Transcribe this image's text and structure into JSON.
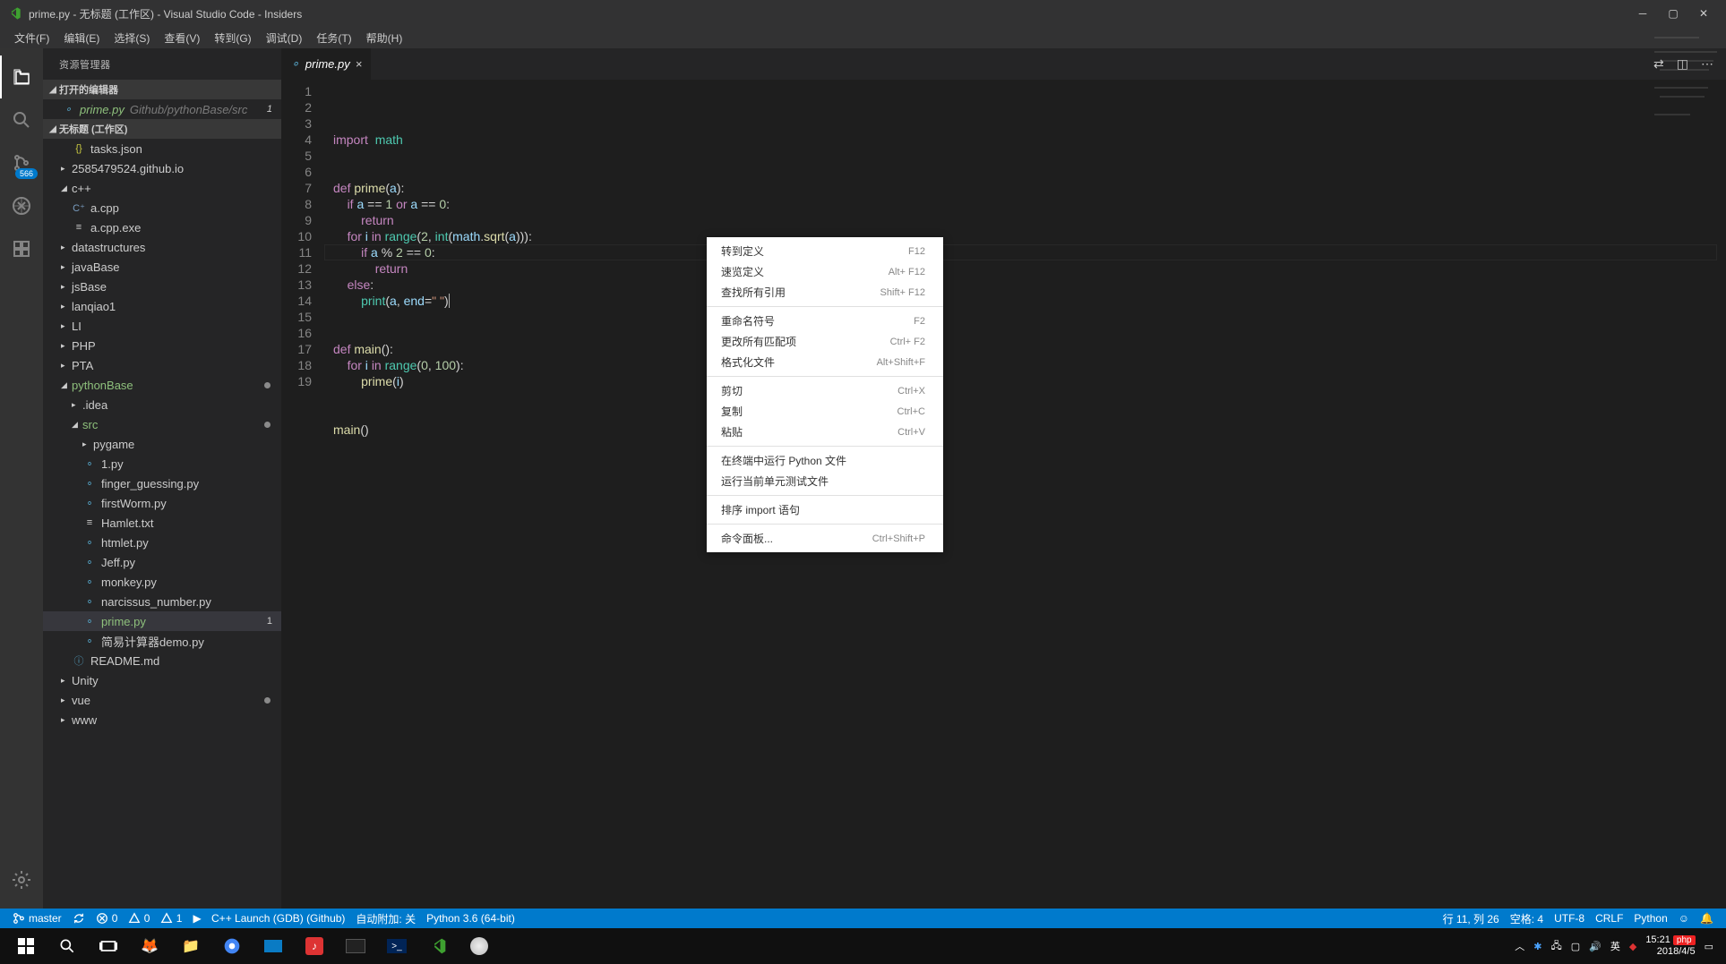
{
  "window": {
    "title": "prime.py - 无标题 (工作区) - Visual Studio Code - Insiders"
  },
  "menu": [
    "文件(F)",
    "编辑(E)",
    "选择(S)",
    "查看(V)",
    "转到(G)",
    "调试(D)",
    "任务(T)",
    "帮助(H)"
  ],
  "activity": {
    "scm_badge": "566"
  },
  "explorer": {
    "title": "资源管理器",
    "openEditorsHeader": "打开的编辑器",
    "openEditor": {
      "name": "prime.py",
      "path": "Github/pythonBase/src",
      "num": "1"
    },
    "workspaceHeader": "无标题 (工作区)",
    "tree": {
      "tasksjson": "tasks.json",
      "github": "2585479524.github.io",
      "cpp": "c++",
      "acpp": "a.cpp",
      "acppexe": "a.cpp.exe",
      "datastructures": "datastructures",
      "javaBase": "javaBase",
      "jsBase": "jsBase",
      "lanqiao1": "lanqiao1",
      "LI": "LI",
      "PHP": "PHP",
      "PTA": "PTA",
      "pythonBase": "pythonBase",
      "idea": ".idea",
      "src": "src",
      "pygame": "pygame",
      "1py": "1.py",
      "finger": "finger_guessing.py",
      "firstWorm": "firstWorm.py",
      "hamlet": "Hamlet.txt",
      "htmlet": "htmlet.py",
      "jeff": "Jeff.py",
      "monkey": "monkey.py",
      "narcissus": "narcissus_number.py",
      "prime": "prime.py",
      "primeNum": "1",
      "calc": "简易计算器demo.py",
      "readme": "README.md",
      "Unity": "Unity",
      "vue": "vue",
      "www": "www"
    }
  },
  "tab": {
    "name": "prime.py"
  },
  "code": {
    "lines": [
      {
        "n": "1",
        "tokens": [
          [
            "kw",
            "import"
          ],
          [
            "",
            "  "
          ],
          [
            "mod",
            "math"
          ]
        ]
      },
      {
        "n": "2",
        "tokens": []
      },
      {
        "n": "3",
        "tokens": []
      },
      {
        "n": "4",
        "tokens": [
          [
            "kw",
            "def"
          ],
          [
            "",
            " "
          ],
          [
            "fn",
            "prime"
          ],
          [
            "op",
            "("
          ],
          [
            "id",
            "a"
          ],
          [
            "op",
            "):"
          ]
        ]
      },
      {
        "n": "5",
        "tokens": [
          [
            "",
            "    "
          ],
          [
            "kw",
            "if"
          ],
          [
            "",
            " "
          ],
          [
            "id",
            "a"
          ],
          [
            "",
            " "
          ],
          [
            "op",
            "=="
          ],
          [
            "",
            " "
          ],
          [
            "num",
            "1"
          ],
          [
            "",
            " "
          ],
          [
            "kw",
            "or"
          ],
          [
            "",
            " "
          ],
          [
            "id",
            "a"
          ],
          [
            "",
            " "
          ],
          [
            "op",
            "=="
          ],
          [
            "",
            " "
          ],
          [
            "num",
            "0"
          ],
          [
            "op",
            ":"
          ]
        ]
      },
      {
        "n": "6",
        "tokens": [
          [
            "",
            "        "
          ],
          [
            "kw",
            "return"
          ]
        ]
      },
      {
        "n": "7",
        "tokens": [
          [
            "",
            "    "
          ],
          [
            "kw",
            "for"
          ],
          [
            "",
            " "
          ],
          [
            "id",
            "i"
          ],
          [
            "",
            " "
          ],
          [
            "kw",
            "in"
          ],
          [
            "",
            " "
          ],
          [
            "bi",
            "range"
          ],
          [
            "op",
            "("
          ],
          [
            "num",
            "2"
          ],
          [
            "op",
            ", "
          ],
          [
            "bi",
            "int"
          ],
          [
            "op",
            "("
          ],
          [
            "id",
            "math"
          ],
          [
            "op",
            "."
          ],
          [
            "fn",
            "sqrt"
          ],
          [
            "op",
            "("
          ],
          [
            "id",
            "a"
          ],
          [
            "op",
            "))):"
          ]
        ]
      },
      {
        "n": "8",
        "tokens": [
          [
            "",
            "        "
          ],
          [
            "kw",
            "if"
          ],
          [
            "",
            " "
          ],
          [
            "id",
            "a"
          ],
          [
            "",
            " "
          ],
          [
            "op",
            "%"
          ],
          [
            "",
            " "
          ],
          [
            "num",
            "2"
          ],
          [
            "",
            " "
          ],
          [
            "op",
            "=="
          ],
          [
            "",
            " "
          ],
          [
            "num",
            "0"
          ],
          [
            "op",
            ":"
          ]
        ]
      },
      {
        "n": "9",
        "tokens": [
          [
            "",
            "            "
          ],
          [
            "kw",
            "return"
          ]
        ]
      },
      {
        "n": "10",
        "tokens": [
          [
            "",
            "    "
          ],
          [
            "kw",
            "else"
          ],
          [
            "op",
            ":"
          ]
        ]
      },
      {
        "n": "11",
        "tokens": [
          [
            "",
            "        "
          ],
          [
            "bi",
            "print"
          ],
          [
            "op",
            "("
          ],
          [
            "id",
            "a"
          ],
          [
            "op",
            ", "
          ],
          [
            "id",
            "end"
          ],
          [
            "op",
            "="
          ],
          [
            "str",
            "\" \""
          ],
          [
            "op",
            ")"
          ]
        ]
      },
      {
        "n": "12",
        "tokens": []
      },
      {
        "n": "13",
        "tokens": []
      },
      {
        "n": "14",
        "tokens": [
          [
            "kw",
            "def"
          ],
          [
            "",
            " "
          ],
          [
            "fn",
            "main"
          ],
          [
            "op",
            "():"
          ]
        ]
      },
      {
        "n": "15",
        "tokens": [
          [
            "",
            "    "
          ],
          [
            "kw",
            "for"
          ],
          [
            "",
            " "
          ],
          [
            "id",
            "i"
          ],
          [
            "",
            " "
          ],
          [
            "kw",
            "in"
          ],
          [
            "",
            " "
          ],
          [
            "bi",
            "range"
          ],
          [
            "op",
            "("
          ],
          [
            "num",
            "0"
          ],
          [
            "op",
            ", "
          ],
          [
            "num",
            "100"
          ],
          [
            "op",
            "):"
          ]
        ]
      },
      {
        "n": "16",
        "tokens": [
          [
            "",
            "        "
          ],
          [
            "fn",
            "prime"
          ],
          [
            "op",
            "("
          ],
          [
            "id",
            "i"
          ],
          [
            "op",
            ")"
          ]
        ]
      },
      {
        "n": "17",
        "tokens": []
      },
      {
        "n": "18",
        "tokens": []
      },
      {
        "n": "19",
        "tokens": [
          [
            "fn",
            "main"
          ],
          [
            "op",
            "()"
          ]
        ]
      }
    ]
  },
  "context": [
    {
      "label": "转到定义",
      "shortcut": "F12"
    },
    {
      "label": "速览定义",
      "shortcut": "Alt+  F12"
    },
    {
      "label": "查找所有引用",
      "shortcut": "Shift+  F12"
    },
    {
      "sep": true
    },
    {
      "label": "重命名符号",
      "shortcut": "F2"
    },
    {
      "label": "更改所有匹配项",
      "shortcut": "Ctrl+  F2"
    },
    {
      "label": "格式化文件",
      "shortcut": "Alt+Shift+F"
    },
    {
      "sep": true
    },
    {
      "label": "剪切",
      "shortcut": "Ctrl+X"
    },
    {
      "label": "复制",
      "shortcut": "Ctrl+C"
    },
    {
      "label": "粘贴",
      "shortcut": "Ctrl+V"
    },
    {
      "sep": true
    },
    {
      "label": "在终端中运行 Python 文件",
      "shortcut": ""
    },
    {
      "label": "运行当前单元测试文件",
      "shortcut": ""
    },
    {
      "sep": true
    },
    {
      "label": "排序 import 语句",
      "shortcut": ""
    },
    {
      "sep": true
    },
    {
      "label": "命令面板...",
      "shortcut": "Ctrl+Shift+P"
    }
  ],
  "status": {
    "branch": "master",
    "errors": "0",
    "warnA": "0",
    "warnB": "1",
    "launch": "C++ Launch (GDB) (Github)",
    "attach": "自动附加: 关",
    "python": "Python 3.6 (64-bit)",
    "pos": "行 11,   列 26",
    "spaces": "空格: 4",
    "enc": "UTF-8",
    "eol": "CRLF",
    "lang": "Python"
  },
  "taskbar": {
    "time": "15:21",
    "date": "2018/4/5",
    "ime": "英",
    "php": "php"
  }
}
